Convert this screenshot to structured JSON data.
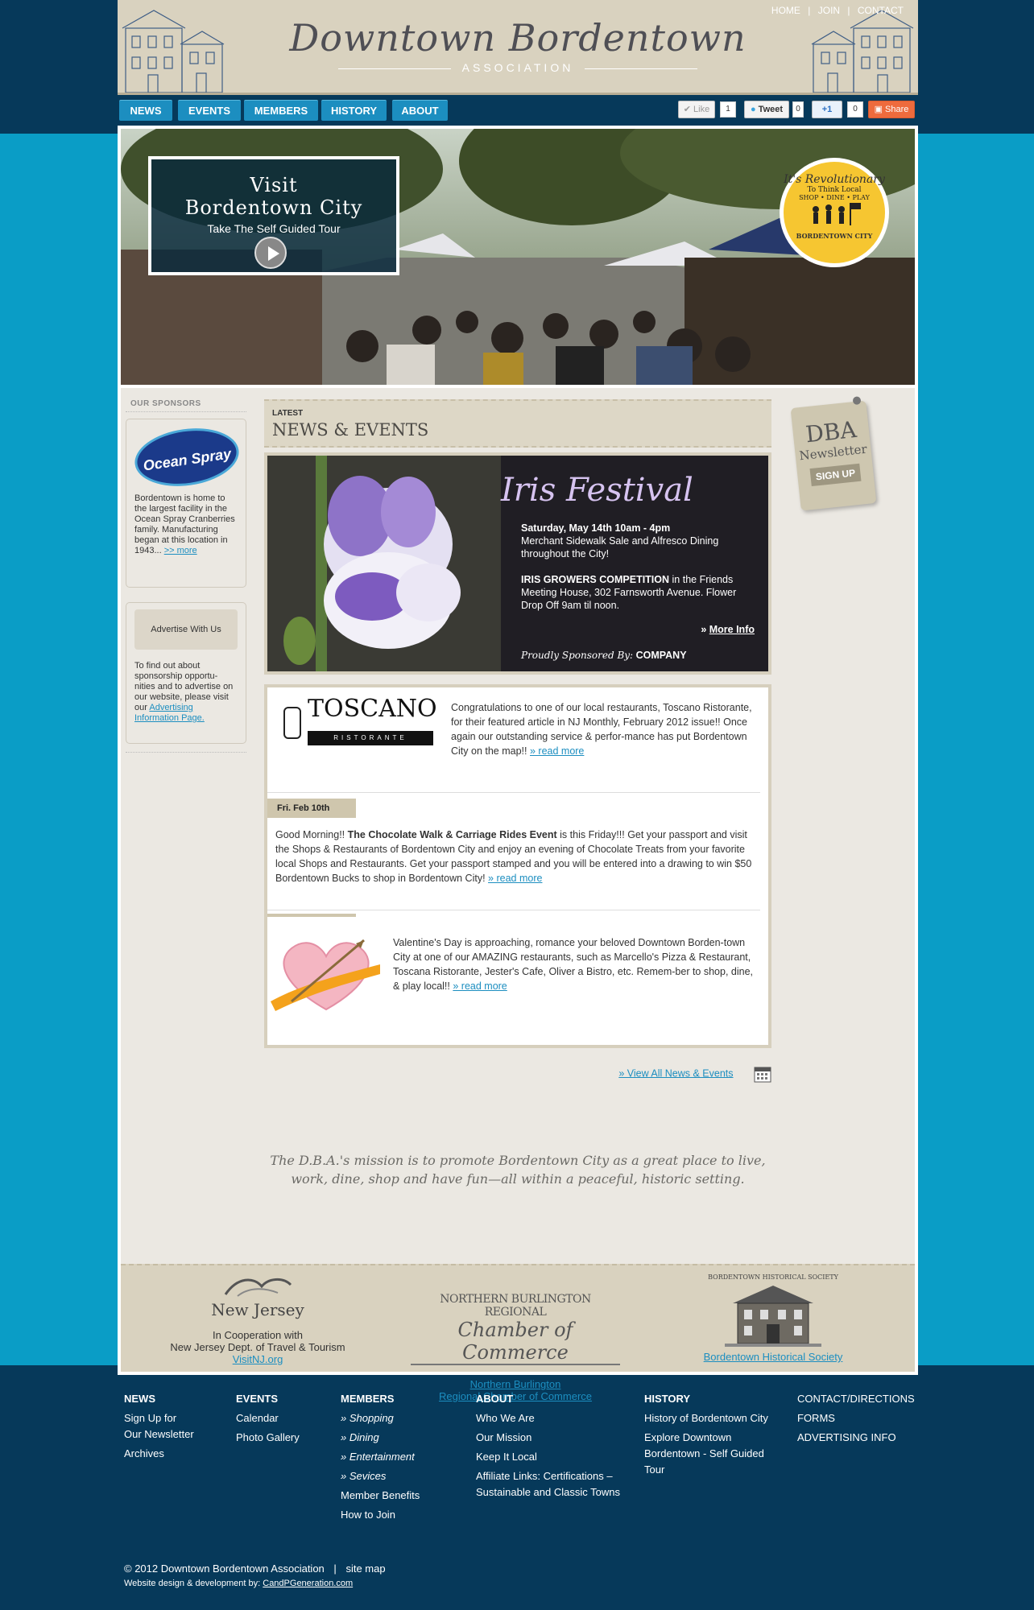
{
  "header": {
    "logo_title": "Downtown Bordentown",
    "logo_subtitle": "ASSOCIATION",
    "top_links": [
      "HOME",
      "JOIN",
      "CONTACT"
    ]
  },
  "nav": {
    "items": [
      "NEWS",
      "EVENTS",
      "MEMBERS",
      "HISTORY",
      "ABOUT"
    ]
  },
  "social": {
    "like_label": "Like",
    "like_count": "1",
    "tweet_label": "Tweet",
    "tweet_count": "0",
    "plus_label": "+1",
    "plus_count": "0",
    "share_label": "Share"
  },
  "hero": {
    "visit_line1": "Visit",
    "visit_line2": "Bordentown City",
    "visit_line3": "Take The Self Guided Tour",
    "badge_line1": "It's Revolutionary",
    "badge_line2": "To Think Local",
    "badge_line3": "SHOP • DINE • PLAY",
    "badge_line4": "BORDENTOWN CITY"
  },
  "sidebar": {
    "sponsors_title": "OUR SPONSORS",
    "ocean_spray_logo": "Ocean Spray",
    "sponsor_text": "Bordentown is home to the largest facility in the Ocean Spray Cranberries family. Manufacturing began at this location in 1943...",
    "sponsor_more": ">> more",
    "advertise_button": "Advertise With Us",
    "advertise_text": "To find out about sponsorship opportu-nities and to advertise on our website, please visit our",
    "advertise_link": "Advertising Information Page."
  },
  "news": {
    "latest_label": "LATEST",
    "heading": "NEWS & EVENTS",
    "feature": {
      "title": "Iris Festival",
      "date_line": "Saturday, May 14th 10am - 4pm",
      "line1": "Merchant Sidewalk Sale and Alfresco Dining throughout the City!",
      "competition_bold": "IRIS GROWERS COMPETITION",
      "competition_rest": " in the Friends Meeting House, 302 Farnsworth Avenue. Flower Drop Off 9am til noon.",
      "more_info": "More Info",
      "sponsored_label": "Proudly Sponsored By:",
      "sponsored_company": "COMPANY"
    },
    "items": [
      {
        "logo_text": "TOSCANO",
        "logo_sub": "RISTORANTE",
        "text": "Congratulations to one of our local restaurants, Toscano Ristorante, for their featured article in NJ Monthly, February 2012 issue!! Once again our outstanding service & perfor-mance has put Bordentown City on the map!!",
        "link": "» read more"
      },
      {
        "date": "Fri. Feb 10th",
        "text_pre": "Good Morning!! ",
        "text_bold": "The Chocolate Walk & Carriage Rides Event",
        "text_post": " is this Friday!!! Get your passport and visit the Shops & Restaurants of Bordentown City and enjoy an evening of Chocolate Treats from your favorite local Shops and Restaurants. Get your passport stamped and you will be entered into a drawing to win $50 Bordentown Bucks to shop in Bordentown City!",
        "link": "» read more"
      },
      {
        "text": "Valentine's Day is approaching, romance your beloved Downtown Borden-town City at one of our AMAZING restaurants, such as Marcello's Pizza & Restaurant, Toscana Ristorante, Jester's Cafe, Oliver a Bistro, etc. Remem-ber to shop, dine, & play local!!",
        "link": "» read more"
      }
    ],
    "view_all": "» View All News & Events"
  },
  "newsletter": {
    "line1": "DBA",
    "line2": "Newsletter",
    "signup": "SIGN UP"
  },
  "mission": {
    "line1": "The D.B.A.'s mission is to promote Bordentown City as a great place to live,",
    "line2": "work, dine, shop and have fun—all within a peaceful, historic setting."
  },
  "partners": {
    "nj_logo": "New Jersey",
    "nj_line1": "In Cooperation with",
    "nj_line2": "New Jersey Dept. of Travel & Tourism",
    "nj_link": "VisitNJ.org",
    "chamber_logo1": "NORTHERN BURLINGTON REGIONAL",
    "chamber_logo2": "Chamber of Commerce",
    "chamber_link1": "Northern Burlington",
    "chamber_link2": "Regional Chamber of Commerce",
    "hist_logo": "BORDENTOWN HISTORICAL SOCIETY",
    "hist_link": "Bordentown Historical Society"
  },
  "footer": {
    "news": {
      "heading": "NEWS",
      "links": [
        "Sign Up for",
        "Our Newsletter",
        "Archives"
      ]
    },
    "events": {
      "heading": "EVENTS",
      "links": [
        "Calendar",
        "Photo Gallery"
      ]
    },
    "members": {
      "heading": "MEMBERS",
      "links": [
        "Shopping",
        "Dining",
        "Entertainment",
        "Sevices",
        "Member Benefits",
        "How to Join"
      ]
    },
    "about": {
      "heading": "ABOUT",
      "links": [
        "Who We Are",
        "Our Mission",
        "Keep It Local",
        "Affiliate Links: Certifications –",
        "Sustainable and Classic Towns"
      ]
    },
    "history": {
      "heading": "HISTORY",
      "links": [
        "History of Bordentown City",
        "Explore Downtown",
        "Bordentown - Self Guided",
        "Tour"
      ]
    },
    "contact": {
      "links": [
        "CONTACT/DIRECTIONS",
        "FORMS",
        "ADVERTISING INFO"
      ]
    },
    "copyright": "© 2012 Downtown Bordentown Association",
    "sitemap": "site map",
    "credit": "Website design & development by:",
    "credit_link": "CandPGeneration.com"
  },
  "colors": {
    "page_bg": "#06395a",
    "accent_blue": "#0a9dc6",
    "nav_blue": "#1c8ec0",
    "tan": "#d9d2bf",
    "badge_yellow": "#f6c631"
  }
}
